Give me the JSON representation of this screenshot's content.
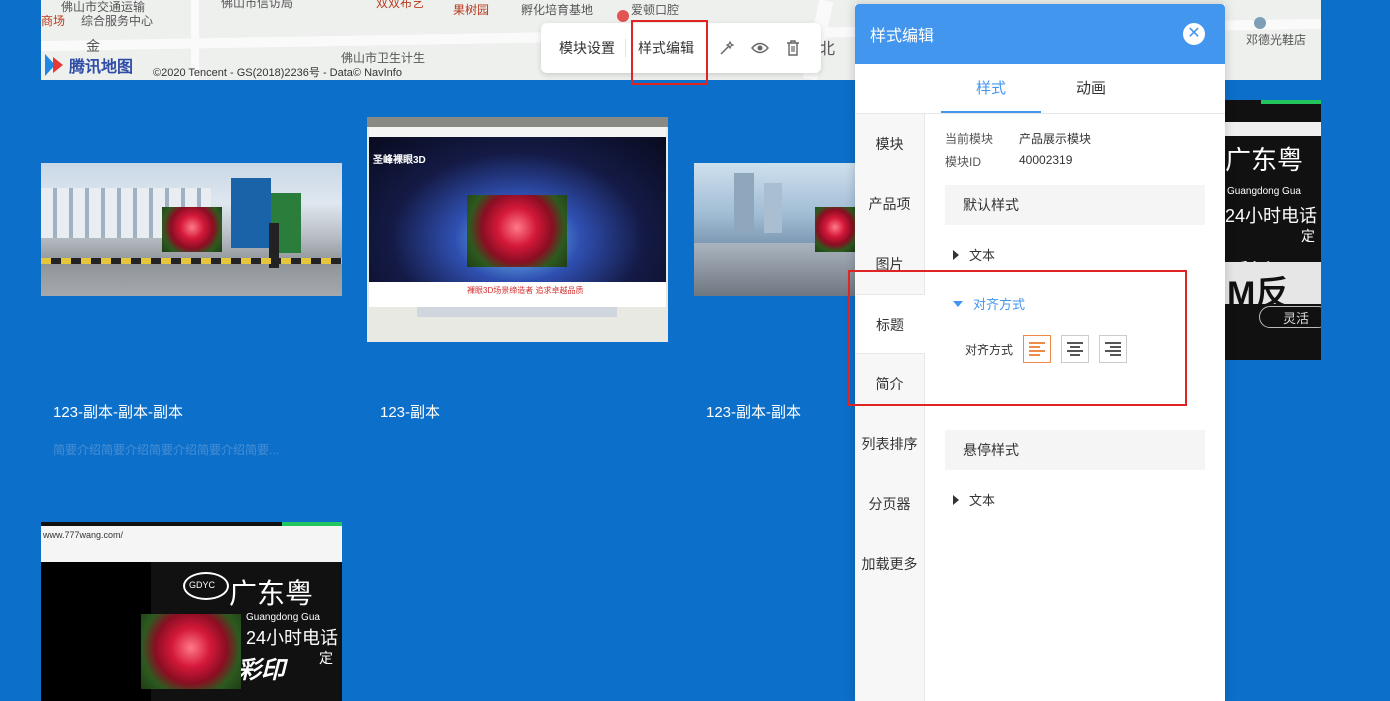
{
  "map": {
    "labels": [
      "佛山市交通运输",
      "综合服务中心",
      "商场",
      "金",
      "佛山市卫生计生",
      "佛山市信访局",
      "双双布艺",
      "果树园",
      "孵化培育基地",
      "爱顿口腔",
      "邓德光鞋店",
      "北"
    ],
    "brand": "腾讯地图",
    "copyright": "©2020 Tencent - GS(2018)2236号 - Data© NavInfo"
  },
  "toolbar": {
    "module_settings": "模块设置",
    "style_edit": "样式编辑"
  },
  "cards": [
    {
      "title": "123-副本-副本-副本",
      "desc": "简要介绍简要介绍简要介绍简要介绍简要..."
    },
    {
      "title": "123-副本",
      "desc": ""
    },
    {
      "title": "123-副本-副本",
      "desc": ""
    }
  ],
  "images": {
    "laptop_brand": "圣峰裸眼3D",
    "laptop_caption": "裸眼3D场景缔造者 追求卓越品质",
    "billboard_big": "广东粤",
    "billboard_sub": "Guangdong Gua",
    "billboard_line": "24小时电话",
    "billboard_reflect": "M反",
    "billboard_logo": "GDYC",
    "url": "www.777wang.com/",
    "ding": "定",
    "ling": "灵活",
    "cai": "彩印"
  },
  "panel": {
    "title": "样式编辑",
    "tabs": [
      {
        "label": "样式"
      },
      {
        "label": "动画"
      }
    ],
    "nav": [
      {
        "label": "模块"
      },
      {
        "label": "产品项"
      },
      {
        "label": "图片"
      },
      {
        "label": "标题"
      },
      {
        "label": "简介"
      },
      {
        "label": "列表排序"
      },
      {
        "label": "分页器"
      },
      {
        "label": "加载更多"
      }
    ],
    "info": {
      "module_key": "当前模块",
      "module_val": "产品展示模块",
      "id_key": "模块ID",
      "id_val": "40002319"
    },
    "default_style": "默认样式",
    "text": "文本",
    "align_section": "对齐方式",
    "align_label": "对齐方式",
    "hover_style": "悬停样式",
    "hover_text": "文本"
  },
  "colors": {
    "accent": "#4396ee",
    "highlight": "#e02323",
    "bg": "#0c6fca",
    "align_active": "#f08a4b"
  }
}
